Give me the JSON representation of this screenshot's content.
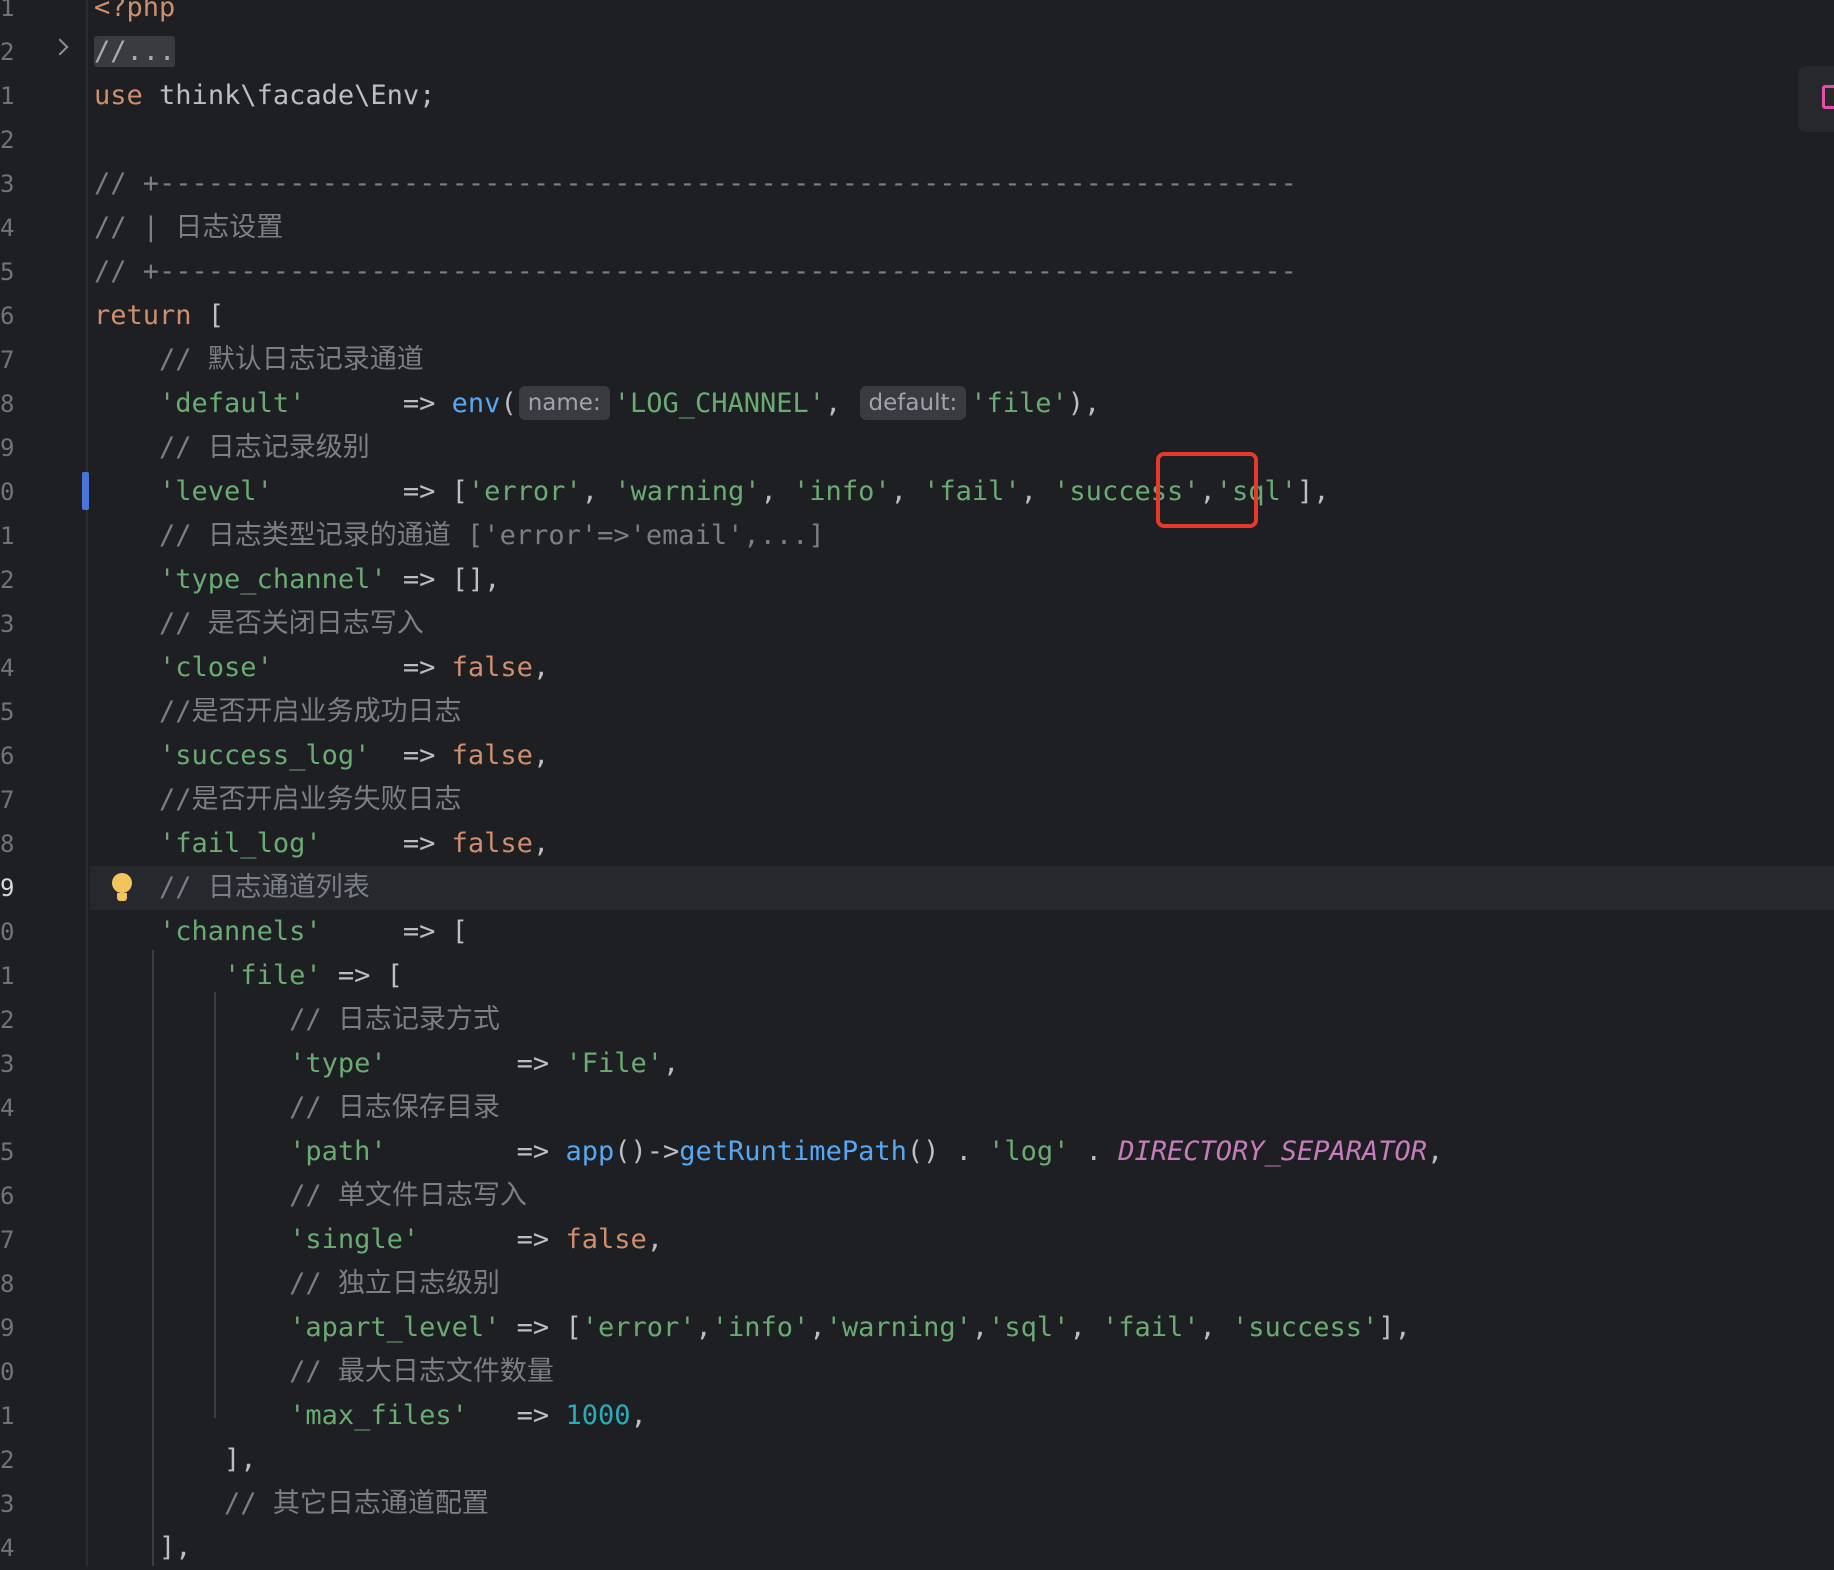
{
  "gutter": {
    "line_numbers": [
      "1",
      "2",
      "1",
      "2",
      "3",
      "4",
      "5",
      "6",
      "7",
      "8",
      "9",
      "0",
      "1",
      "2",
      "3",
      "4",
      "5",
      "6",
      "7",
      "8",
      "9",
      "0",
      "1",
      "2",
      "3",
      "4",
      "5",
      "6",
      "7",
      "8",
      "9",
      "0",
      "1",
      "2",
      "3",
      "4"
    ],
    "active_index": 20
  },
  "code": {
    "php_open": "<?php",
    "folded": "//...",
    "use_kw": "use",
    "use_ns": "think\\facade\\Env;",
    "sep": "// +----------------------------------------------------------------------",
    "header_comment": "// | 日志设置",
    "return_kw": "return",
    "bracket_open": "[",
    "c_default": "// 默认日志记录通道",
    "k_default": "'default'",
    "arrow": "=>",
    "fn_env": "env",
    "hint_name": "name:",
    "s_log_channel": "'LOG_CHANNEL'",
    "hint_default": "default:",
    "s_file": "'file'",
    "c_level": "// 日志记录级别",
    "k_level": "'level'",
    "s_error": "'error'",
    "s_warning": "'warning'",
    "s_info": "'info'",
    "s_fail": "'fail'",
    "s_success": "'success'",
    "s_sql": "'sql'",
    "c_type_channel": "// 日志类型记录的通道 ['error'=>'email',...]",
    "k_type_channel": "'type_channel'",
    "empty_arr": "[]",
    "c_close": "// 是否关闭日志写入",
    "k_close": "'close'",
    "false_kw": "false",
    "c_success_log": "//是否开启业务成功日志",
    "k_success_log": "'success_log'",
    "c_fail_log": "//是否开启业务失败日志",
    "k_fail_log": "'fail_log'",
    "c_channels": "// 日志通道列表",
    "k_channels": "'channels'",
    "k_file": "'file'",
    "c_type": "// 日志记录方式",
    "k_type": "'type'",
    "s_File": "'File'",
    "c_path": "// 日志保存目录",
    "k_path": "'path'",
    "fn_app": "app",
    "fn_get_runtime": "getRuntimePath",
    "s_log": "'log'",
    "const_dir_sep": "DIRECTORY_SEPARATOR",
    "c_single": "// 单文件日志写入",
    "k_single": "'single'",
    "c_apart": "// 独立日志级别",
    "k_apart": "'apart_level'",
    "c_max_files": "// 最大日志文件数量",
    "k_max_files": "'max_files'",
    "n_1000": "1000",
    "c_other": "// 其它日志通道配置"
  },
  "colors": {
    "background": "#1e1f22",
    "keyword": "#cf8e6d",
    "string": "#6aab73",
    "comment": "#7a7e85",
    "function": "#56a8f5",
    "number": "#2aacb8",
    "constant": "#c77dbb",
    "annotation_box": "#e6392a"
  },
  "icons": [
    "chevron-right-icon",
    "lightbulb-icon",
    "plugin-icon"
  ]
}
